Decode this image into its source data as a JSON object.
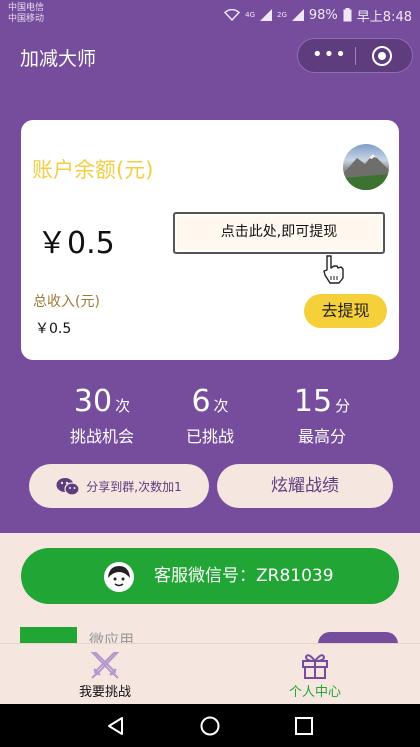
{
  "status": {
    "carrier1": "中国电信",
    "carrier2": "中国移动",
    "net1": "4G",
    "net2": "2G",
    "battery": "98%",
    "time": "早上8:48"
  },
  "app": {
    "title": "加减大师"
  },
  "card": {
    "balance_title": "账户余额(元)",
    "balance_value": "￥0.5",
    "tip": "点击此处,即可提现",
    "income_label": "总收入(元)",
    "income_value": "￥0.5",
    "withdraw_label": "去提现"
  },
  "stats": [
    {
      "value": "30",
      "unit": "次",
      "label": "挑战机会"
    },
    {
      "value": "6",
      "unit": "次",
      "label": "已挑战"
    },
    {
      "value": "15",
      "unit": "分",
      "label": "最高分"
    }
  ],
  "actions": {
    "share_label": "分享到群,次数加1",
    "show_label": "炫耀战绩"
  },
  "service": {
    "label": "客服微信号：ZR81039"
  },
  "mini_app": {
    "name": "微应用"
  },
  "tabs": [
    {
      "label": "我要挑战",
      "icon": "crossed-swords-icon",
      "color": "#111111"
    },
    {
      "label": "个人中心",
      "icon": "gift-icon",
      "color": "#21A535"
    }
  ],
  "colors": {
    "primary_purple": "#764C9C",
    "accent_yellow": "#F5D03A",
    "title_yellow": "#F3CE43",
    "green": "#21A535",
    "background": "#F5E6E0"
  }
}
